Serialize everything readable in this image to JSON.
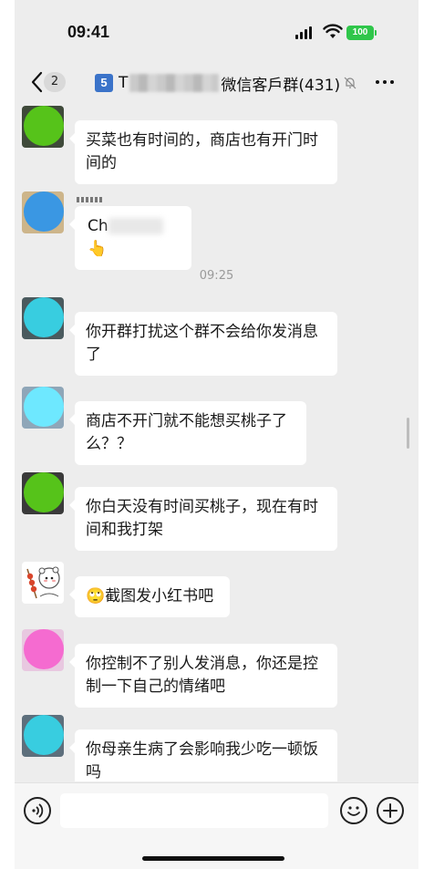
{
  "status_bar": {
    "time": "09:41",
    "battery": "100"
  },
  "nav": {
    "back_badge": "2",
    "group_number_icon": "5",
    "title_prefix": "T",
    "title_suffix": "微信客戶群(431)",
    "icons": [
      "chevron-left-icon",
      "mute-bell-icon",
      "more-icon"
    ]
  },
  "chat": {
    "timestamp": "09:25",
    "messages": [
      {
        "avatar_color": "#56c31a",
        "text": "买菜也有时间的，商店也有开门时间的"
      },
      {
        "avatar_color": "#3a97e3",
        "text": "Ch",
        "emoji": "👆"
      },
      {
        "avatar_color": "#38cde0",
        "text": "你开群打扰这个群不会给你发消息了"
      },
      {
        "avatar_color": "#6ee8ff",
        "text": "商店不开门就不能想买桃子了么？？"
      },
      {
        "avatar_color": "#56c31a",
        "text": "你白天没有时间买桃子，现在有时间和我打架"
      },
      {
        "avatar_color": "#ffffff",
        "text": "截图发小红书吧",
        "emoji": "🙄"
      },
      {
        "avatar_color": "#f56bd0",
        "text": "你控制不了别人发消息，你还是控制一下自己的情绪吧"
      },
      {
        "avatar_color": "#38cde0",
        "text": "你母亲生病了会影响我少吃一顿饭吗"
      }
    ]
  },
  "input_bar": {
    "placeholder": "",
    "icons": [
      "voice-icon",
      "emoji-icon",
      "plus-icon"
    ]
  },
  "colors": {
    "chat_bg": "#ededed",
    "bubble_bg": "#ffffff",
    "battery_green": "#2fc64a"
  }
}
